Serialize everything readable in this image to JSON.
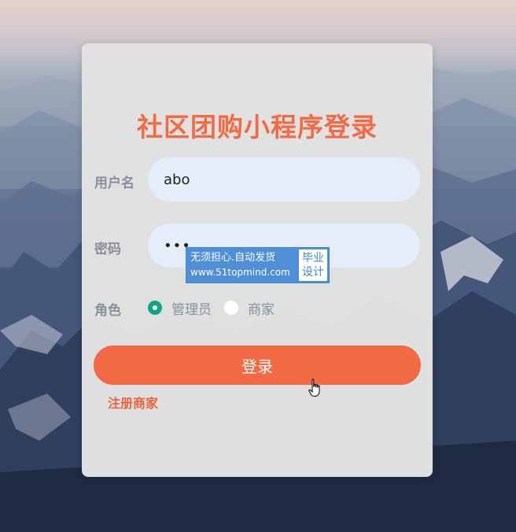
{
  "login_card": {
    "title": "社区团购小程序登录",
    "username_label": "用户名",
    "username_value": "abo",
    "password_label": "密码",
    "password_value": "•••",
    "role_label": "角色",
    "roles": [
      {
        "label": "管理员",
        "checked": true
      },
      {
        "label": "商家",
        "checked": false
      }
    ],
    "login_button": "登录",
    "register_link": "注册商家"
  },
  "watermark": {
    "line1": "无须担心.自动发货",
    "line2": "www.51topmind.com",
    "badge_line1": "毕业",
    "badge_line2": "设计"
  },
  "colors": {
    "accent": "#f26a43",
    "radio_checked": "#0fa57f",
    "input_bg": "#e5edf9",
    "label": "#8a8f99"
  },
  "icons": {
    "cursor": "hand-pointer-icon"
  }
}
